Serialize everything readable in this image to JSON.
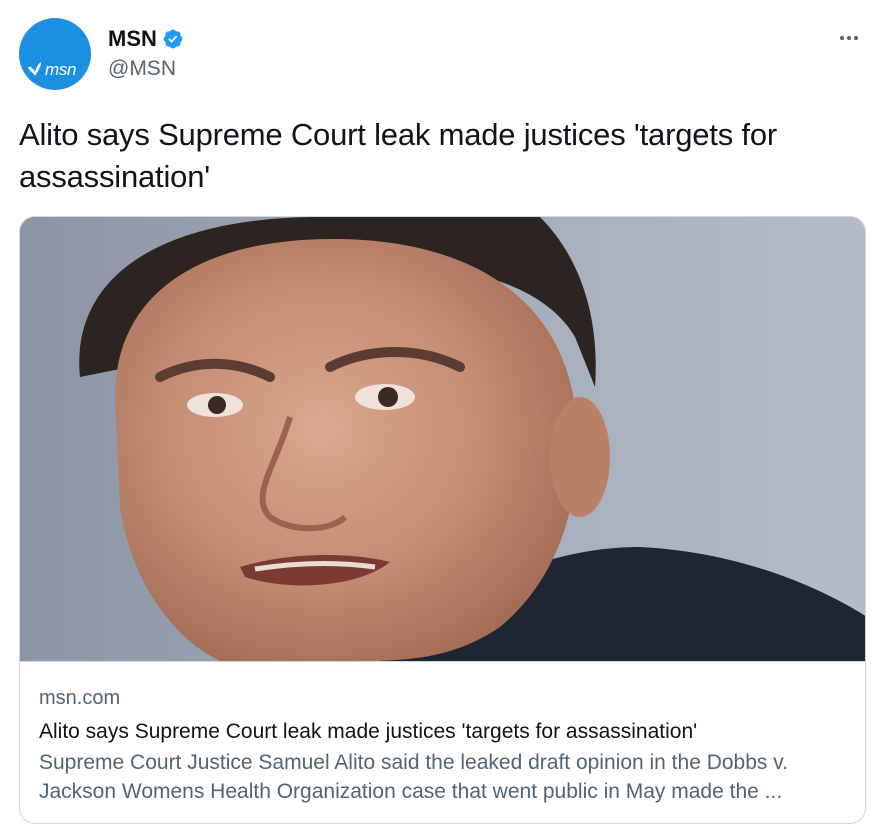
{
  "author": {
    "display_name": "MSN",
    "handle": "@MSN",
    "avatar_logo_text": "msn",
    "verified": true,
    "brand_color": "#1d8fe3",
    "verified_color": "#1d9bf0"
  },
  "tweet": {
    "text": "Alito says Supreme Court leak made justices 'targets for assassination'"
  },
  "card": {
    "image_icon": "portrait-photo",
    "domain": "msn.com",
    "title": "Alito says Supreme Court leak made justices 'targets for assassination'",
    "description": "Supreme Court Justice Samuel Alito said the leaked draft opinion in the Dobbs v. Jackson Womens Health Organization case that went public in May made the ..."
  },
  "colors": {
    "text_primary": "#0f1419",
    "text_secondary": "#536471",
    "border": "#cfd9de"
  }
}
